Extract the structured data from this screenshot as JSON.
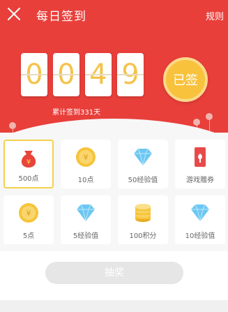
{
  "header": {
    "title": "每日签到",
    "rules_label": "规则"
  },
  "counter": {
    "digits": [
      "0",
      "0",
      "4",
      "9"
    ],
    "total_text": "累计签到331天"
  },
  "signin": {
    "status_label": "已签"
  },
  "rewards": [
    {
      "label": "500点",
      "icon": "money-bag-icon",
      "selected": true
    },
    {
      "label": "10点",
      "icon": "gold-coin-icon",
      "selected": false
    },
    {
      "label": "50经验值",
      "icon": "diamond-icon",
      "selected": false
    },
    {
      "label": "游戏赠券",
      "icon": "game-ticket-icon",
      "selected": false
    },
    {
      "label": "5点",
      "icon": "gold-coin-icon",
      "selected": false
    },
    {
      "label": "5经验值",
      "icon": "diamond-icon",
      "selected": false
    },
    {
      "label": "100积分",
      "icon": "coin-stack-icon",
      "selected": false
    },
    {
      "label": "10经验值",
      "icon": "diamond-icon",
      "selected": false
    }
  ],
  "actions": {
    "lottery_label": "抽奖"
  },
  "colors": {
    "primary_red": "#e83f3a",
    "gold": "#f8c23c",
    "diamond_blue": "#6cc7f2"
  }
}
